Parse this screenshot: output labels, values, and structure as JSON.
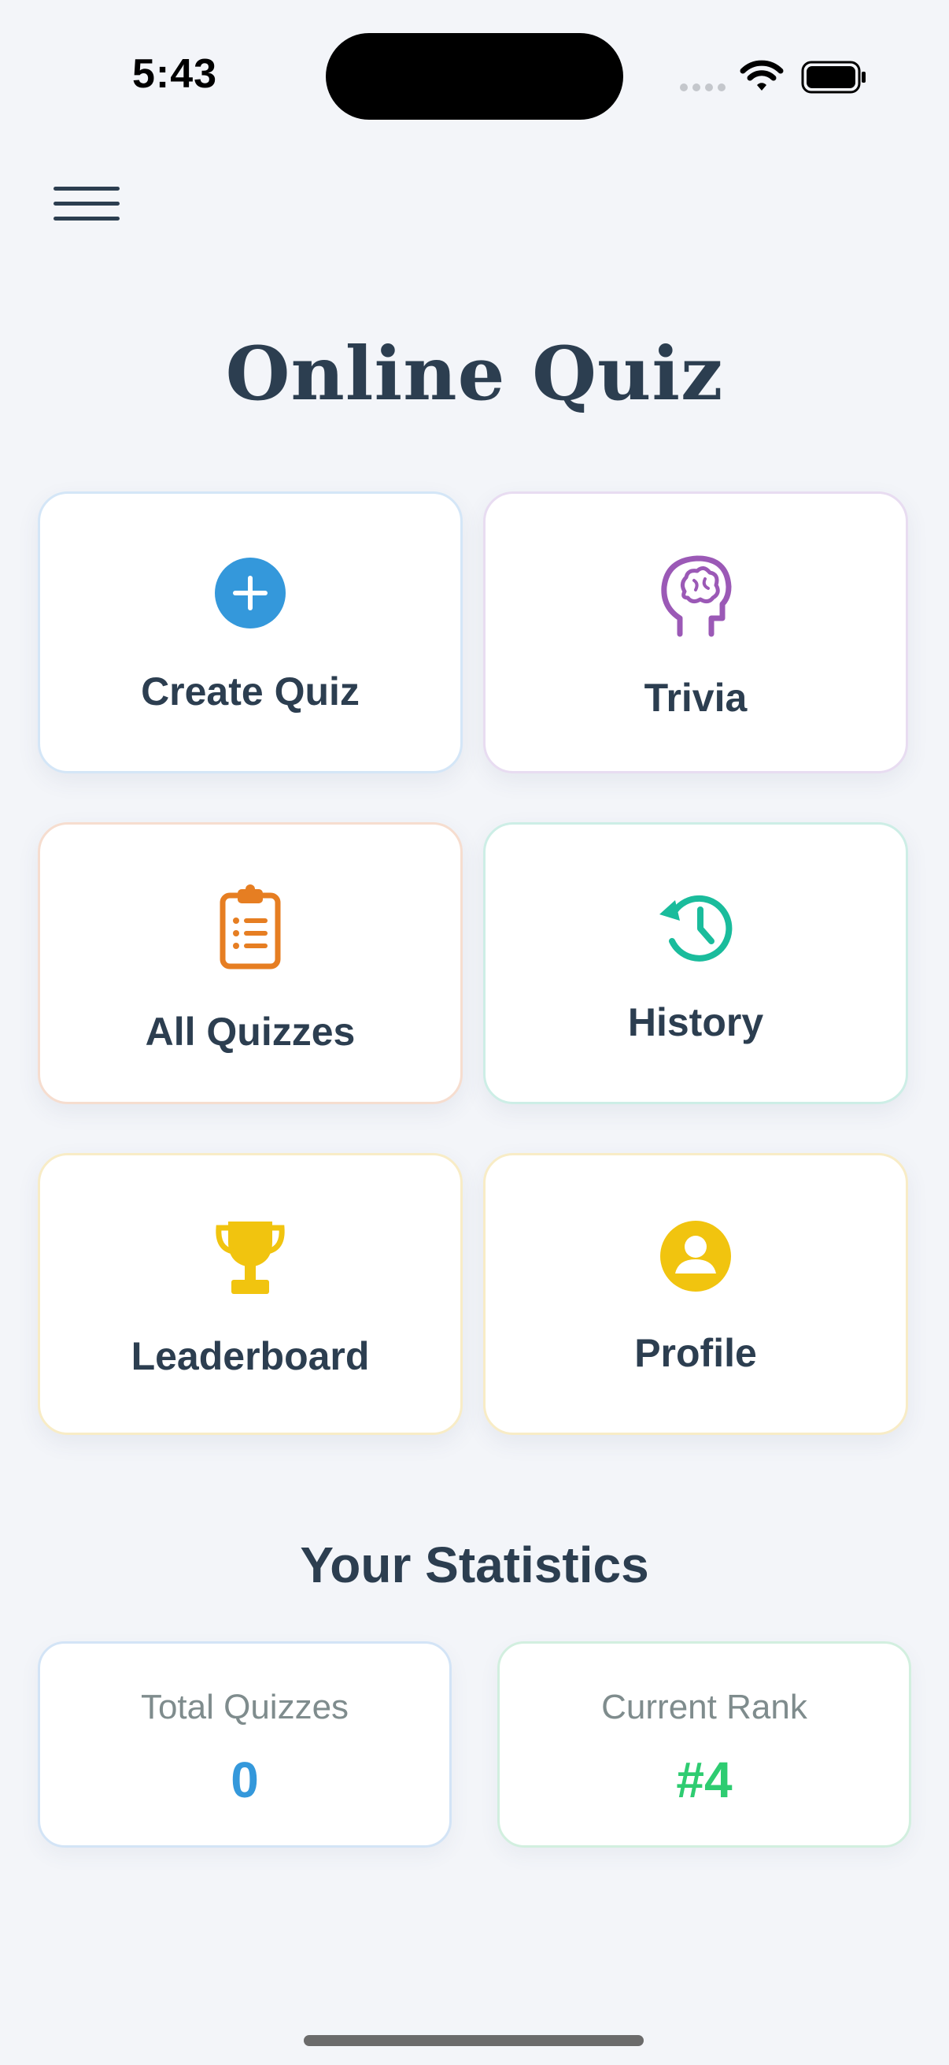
{
  "status_bar": {
    "time": "5:43"
  },
  "header": {
    "title": "Online Quiz"
  },
  "tiles": [
    {
      "label": "Create Quiz",
      "icon": "plus-circle-icon",
      "color": "#3498db"
    },
    {
      "label": "Trivia",
      "icon": "brain-head-icon",
      "color": "#9b59b6"
    },
    {
      "label": "All Quizzes",
      "icon": "clipboard-list-icon",
      "color": "#e67e22"
    },
    {
      "label": "History",
      "icon": "history-clock-icon",
      "color": "#1abc9c"
    },
    {
      "label": "Leaderboard",
      "icon": "trophy-icon",
      "color": "#f1c40f"
    },
    {
      "label": "Profile",
      "icon": "user-circle-icon",
      "color": "#f1c40f"
    }
  ],
  "statistics": {
    "heading": "Your Statistics",
    "cards": [
      {
        "label": "Total Quizzes",
        "value": "0",
        "color": "#3498db"
      },
      {
        "label": "Current Rank",
        "value": "#4",
        "color": "#2ecc71"
      }
    ]
  }
}
